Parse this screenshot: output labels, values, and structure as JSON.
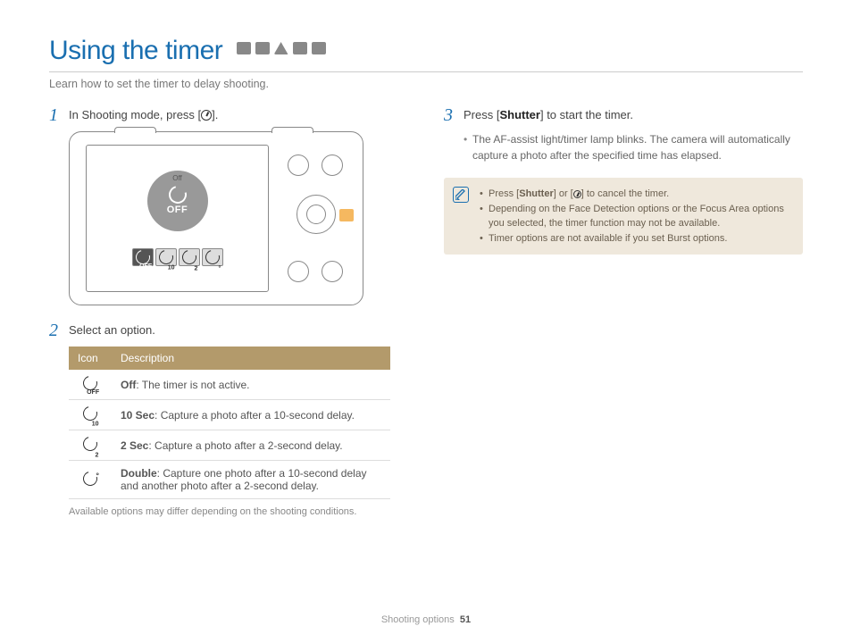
{
  "title": "Using the timer",
  "intro": "Learn how to set the timer to delay shooting.",
  "step1": {
    "pre": "In Shooting mode, press [",
    "post": "]."
  },
  "camera_overlay": {
    "off_caption": "Off",
    "off_big": "OFF"
  },
  "step2": "Select an option.",
  "table": {
    "head_icon": "Icon",
    "head_desc": "Description",
    "rows": [
      {
        "sub": "OFF",
        "label": "Off",
        "desc": ": The timer is not active."
      },
      {
        "sub": "10",
        "label": "10 Sec",
        "desc": ": Capture a photo after a 10-second delay."
      },
      {
        "sub": "2",
        "label": "2 Sec",
        "desc": ": Capture a photo after a 2-second delay."
      },
      {
        "sub": "",
        "label": "Double",
        "desc": ": Capture one photo after a 10-second delay and another photo after a 2-second delay."
      }
    ]
  },
  "caption": "Available options may differ depending on the shooting conditions.",
  "step3": {
    "pre": "Press [",
    "btn": "Shutter",
    "post": "] to start the timer."
  },
  "step3_bullets": [
    "The AF-assist light/timer lamp blinks. The camera will automatically capture a photo after the specified time has elapsed."
  ],
  "note": {
    "b1_pre": "Press [",
    "b1_btn": "Shutter",
    "b1_mid": "] or [",
    "b1_post": "] to cancel the timer.",
    "b2": "Depending on the Face Detection options or the Focus Area options you selected, the timer function may not be available.",
    "b3": "Timer options are not available if you set Burst options."
  },
  "footer": {
    "section": "Shooting options",
    "page": "51"
  }
}
